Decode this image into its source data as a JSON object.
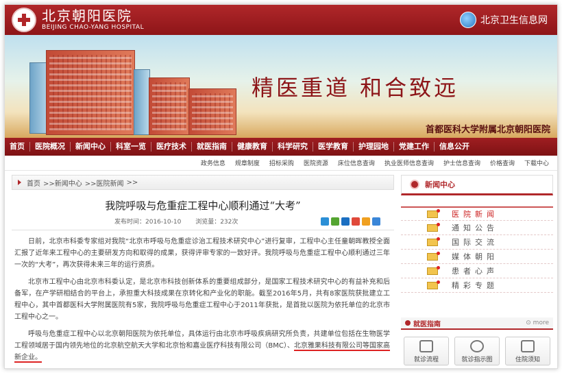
{
  "header": {
    "logo_cn": "北京朝阳医院",
    "logo_en": "BEIJING CHAO-YANG HOSPITAL",
    "info_link": "北京卫生信息网"
  },
  "banner": {
    "slogan": "精医重道 和合致远",
    "affiliation": "首都医科大学附属北京朝阳医院"
  },
  "nav": {
    "items": [
      "首页",
      "医院概况",
      "新闻中心",
      "科室一览",
      "医疗技术",
      "就医指南",
      "健康教育",
      "科学研究",
      "医学教育",
      "护理园地",
      "党建工作",
      "信息公开"
    ]
  },
  "subnav": {
    "items": [
      "政务信息",
      "规章制度",
      "招标采购",
      "医院资源",
      "床位信息查询",
      "执业医师信息查询",
      "护士信息查询",
      "价格查询",
      "下载中心"
    ]
  },
  "breadcrumb": {
    "home": "首页",
    "news": ">>新闻中心",
    "section": ">>医院新闻",
    "tail": ">>"
  },
  "article": {
    "title": "我院呼吸与危重症工程中心顺利通过“大考”",
    "published": "发布时间：2016-10-10",
    "views": "浏览量：232次",
    "p1": "日前，北京市科委专家组对我院“北京市呼吸与危重症诊治工程技术研究中心”进行复审，工程中心主任童朝晖教授全面汇报了近年来工程中心的主要研发方向和取得的成果，获得评审专家的一致好评。我院呼吸与危重症工程中心顺利通过三年一次的“大考”，再次获得未来三年的运行资质。",
    "p2": "北京市工程中心由北京市科委认定，是北京市科技创新体系的重要组成部分，是国家工程技术研究中心的有益补充和后备军，在产学研相结合的平台上，承担重大科技成果在京转化和产业化的职能。截至2016年5月，共有8家医院获批建立工程中心，其中首都医科大学附属医院有5家，我院呼吸与危重症工程中心于2011年获批，是首批以医院为依托单位的北京市工程中心之一。",
    "p3a": "呼吸与危重症工程中心以北京朝阳医院为依托单位，具体运行由北京市呼吸疾病研究所负责，共建单位包括在生物医学工程领域居于国内领先地位的北京航空航天大学和北京怡和嘉业医疗科技有限公司（BMC）、",
    "p3b": "北京雅果科技有限公司等国家高新企业。"
  },
  "sidebar": {
    "news_center": "新闻中心",
    "news_items": [
      "医院新闻",
      "通知公告",
      "国际交流",
      "媒体朝阳",
      "患者心声",
      "精彩专题"
    ],
    "guide_title": "就医指南",
    "guide_more": "more",
    "guide_tiles": [
      "就诊流程",
      "就诊指示图",
      "住院须知"
    ]
  },
  "colors": {
    "brand_red": "#b0272a",
    "nav_red": "#8d1518",
    "share_icons": [
      "#2b8fd6",
      "#55a532",
      "#1b6fc2",
      "#e0493a",
      "#f0a020",
      "#3a86d8"
    ]
  }
}
